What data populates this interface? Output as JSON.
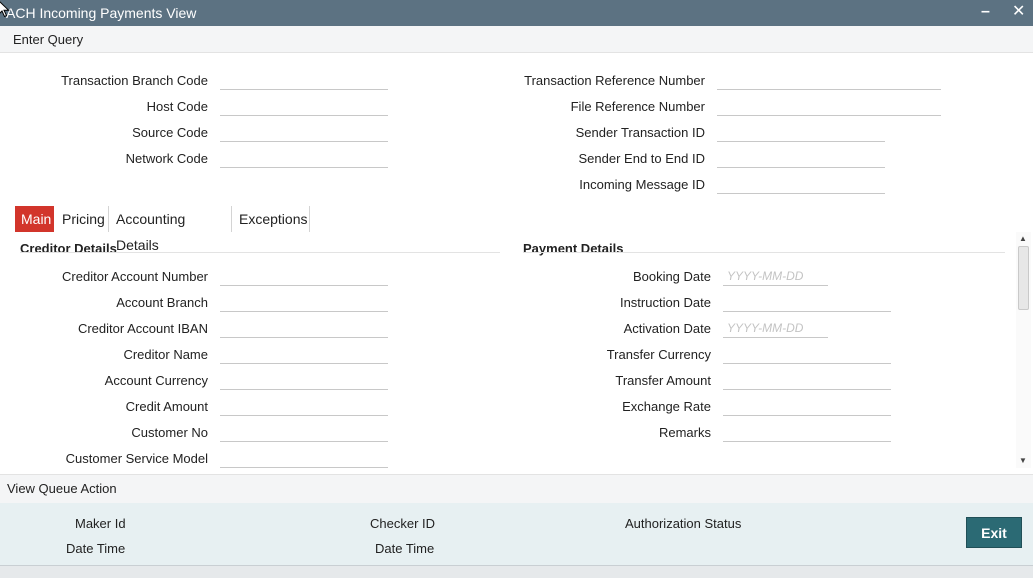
{
  "window": {
    "title": "ACH Incoming Payments View",
    "minimize_icon": "minimize-icon",
    "close_icon": "close-icon"
  },
  "menu": {
    "enter_query": "Enter Query"
  },
  "header": {
    "left": [
      {
        "label": "Transaction Branch Code",
        "value": ""
      },
      {
        "label": "Host Code",
        "value": ""
      },
      {
        "label": "Source Code",
        "value": ""
      },
      {
        "label": "Network Code",
        "value": ""
      }
    ],
    "right": [
      {
        "label": "Transaction Reference Number",
        "value": ""
      },
      {
        "label": "File Reference Number",
        "value": ""
      },
      {
        "label": "Sender Transaction ID",
        "value": ""
      },
      {
        "label": "Sender End to End ID",
        "value": ""
      },
      {
        "label": "Incoming Message ID",
        "value": ""
      }
    ]
  },
  "tabs": [
    {
      "label": "Main",
      "active": true
    },
    {
      "label": "Pricing",
      "active": false
    },
    {
      "label": "Accounting Details",
      "active": false
    },
    {
      "label": "Exceptions",
      "active": false
    }
  ],
  "creditor": {
    "heading": "Creditor Details",
    "fields": [
      {
        "label": "Creditor Account Number",
        "value": ""
      },
      {
        "label": "Account Branch",
        "value": ""
      },
      {
        "label": "Creditor Account IBAN",
        "value": ""
      },
      {
        "label": "Creditor Name",
        "value": ""
      },
      {
        "label": "Account Currency",
        "value": ""
      },
      {
        "label": "Credit Amount",
        "value": ""
      },
      {
        "label": "Customer No",
        "value": ""
      },
      {
        "label": "Customer Service Model",
        "value": ""
      }
    ]
  },
  "payment": {
    "heading": "Payment Details",
    "fields": [
      {
        "label": "Booking Date",
        "value": "",
        "placeholder": "YYYY-MM-DD"
      },
      {
        "label": "Instruction Date",
        "value": "",
        "placeholder": ""
      },
      {
        "label": "Activation Date",
        "value": "",
        "placeholder": "YYYY-MM-DD"
      },
      {
        "label": "Transfer Currency",
        "value": "",
        "placeholder": ""
      },
      {
        "label": "Transfer Amount",
        "value": "",
        "placeholder": ""
      },
      {
        "label": "Exchange Rate",
        "value": "",
        "placeholder": ""
      },
      {
        "label": "Remarks",
        "value": "",
        "placeholder": ""
      }
    ]
  },
  "queue": {
    "action": "View Queue Action"
  },
  "audit": {
    "maker_id": "Maker Id",
    "maker_datetime": "Date Time",
    "checker_id": "Checker ID",
    "checker_datetime": "Date Time",
    "auth_status": "Authorization Status"
  },
  "buttons": {
    "exit": "Exit"
  },
  "colors": {
    "titlebar": "#5c7282",
    "active_tab": "#d2352b",
    "exit_button": "#2b6a74",
    "audit_bg": "#e7f0f2"
  }
}
